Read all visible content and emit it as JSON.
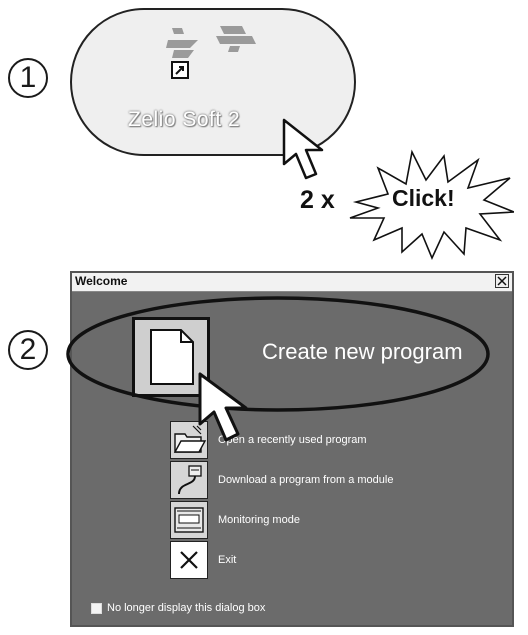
{
  "steps": {
    "one": "1",
    "two": "2"
  },
  "desktop": {
    "shortcut_label": "Zelio Soft 2",
    "double_click_text": "2 x",
    "click_burst_text": "Click!"
  },
  "window": {
    "title": "Welcome",
    "close_symbol": "X",
    "create_new_label": "Create new program",
    "options": [
      {
        "label": "Open a recently used program",
        "icon": "open-folder-icon"
      },
      {
        "label": "Download a program from a module",
        "icon": "download-cable-icon"
      },
      {
        "label": "Monitoring mode",
        "icon": "monitor-module-icon"
      },
      {
        "label": "Exit",
        "icon": "exit-x-icon"
      }
    ],
    "checkbox_label": "No longer display this dialog box"
  },
  "colors": {
    "dialog_background": "#6b6b6b",
    "callout_background": "#efefef",
    "outline": "#111111"
  }
}
